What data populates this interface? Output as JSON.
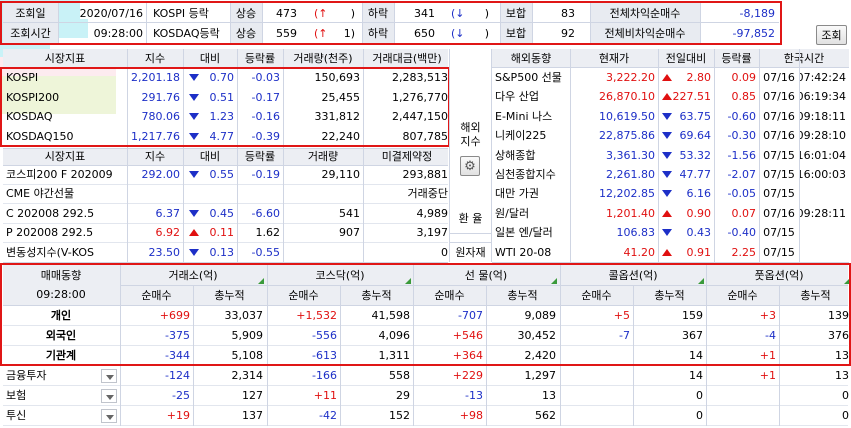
{
  "top": {
    "row1": {
      "label": "조회일",
      "value": "2020/07/16",
      "market": "KOSPI 등락",
      "up_label": "상승",
      "up": "473",
      "up_arrow": "(↑",
      "up_close": ")",
      "down_label": "하락",
      "down": "341",
      "down_arrow": "(↓",
      "down_close": ")",
      "flat_label": "보합",
      "flat": "83",
      "net_label": "전체차익순매수",
      "net": "-8,189"
    },
    "row2": {
      "label": "조회시간",
      "value": "09:28:00",
      "market": "KOSDAQ등락",
      "up_label": "상승",
      "up": "559",
      "up_arrow": "(↑",
      "up_close": "1)",
      "down_label": "하락",
      "down": "650",
      "down_arrow": "(↓",
      "down_close": ")",
      "flat_label": "보합",
      "flat": "92",
      "net_label": "전체비차익순매수",
      "net": "-97,852"
    },
    "query_button": "조회"
  },
  "index_table": {
    "headers": [
      "시장지표",
      "지수",
      "대비",
      "등락률",
      "거래량(천주)",
      "거래대금(백만)"
    ],
    "rows": [
      [
        "KOSPI",
        "2,201.18",
        "0.70",
        "-0.03",
        "150,693",
        "2,283,513"
      ],
      [
        "KOSPI200",
        "291.76",
        "0.51",
        "-0.17",
        "25,455",
        "1,276,770"
      ],
      [
        "KOSDAQ",
        "780.06",
        "1.23",
        "-0.16",
        "331,812",
        "2,447,150"
      ],
      [
        "KOSDAQ150",
        "1,217.76",
        "4.77",
        "-0.39",
        "22,240",
        "807,785"
      ]
    ],
    "headers2": [
      "시장지표",
      "지수",
      "대비",
      "등락률",
      "거래량",
      "미결제약정"
    ],
    "rows2": [
      [
        "코스피200 F 202009",
        "292.00",
        "0.55",
        "-0.19",
        "29,110",
        "293,881"
      ],
      [
        "CME 야간선물",
        "",
        "",
        "",
        "",
        "거래중단"
      ],
      [
        "C 202008 292.5",
        "6.37",
        "0.45",
        "-6.60",
        "541",
        "4,989"
      ],
      [
        "P 202008 292.5",
        "6.92",
        "0.11",
        "1.62",
        "907",
        "3,197"
      ],
      [
        "변동성지수(V-KOS",
        "23.50",
        "0.13",
        "-0.55",
        "",
        "0"
      ]
    ]
  },
  "side_labels": {
    "overseas": "해외\n지수",
    "fx": "환 율",
    "commodity": "원자재"
  },
  "overseas": {
    "headers": [
      "해외동향",
      "현재가",
      "전일대비",
      "등락률",
      "한국시간"
    ],
    "rows": [
      [
        "S&P500 선물",
        "3,222.20",
        "2.80",
        "0.09",
        "07/16",
        "07:42:24"
      ],
      [
        "다우 산업",
        "26,870.10",
        "227.51",
        "0.85",
        "07/16",
        "06:19:34"
      ],
      [
        "E-Mini 나스",
        "10,619.50",
        "63.75",
        "-0.60",
        "07/16",
        "09:18:11"
      ],
      [
        "니케이225",
        "22,875.86",
        "69.64",
        "-0.30",
        "07/16",
        "09:28:10"
      ],
      [
        "상해종합",
        "3,361.30",
        "53.32",
        "-1.56",
        "07/15",
        "16:01:04"
      ],
      [
        "심천종합지수",
        "2,261.80",
        "47.77",
        "-2.07",
        "07/15",
        "16:00:03"
      ],
      [
        "대만 가권",
        "12,202.85",
        "6.16",
        "-0.05",
        "07/15",
        ""
      ],
      [
        "원/달러",
        "1,201.40",
        "0.90",
        "0.07",
        "07/16",
        "09:28:11"
      ],
      [
        "일본 엔/달러",
        "106.83",
        "0.43",
        "-0.40",
        "07/15",
        ""
      ],
      [
        "WTI 20-08",
        "41.20",
        "0.91",
        "2.25",
        "07/15",
        ""
      ]
    ]
  },
  "investor": {
    "title": "매매동향",
    "time": "09:28:00",
    "groups": [
      "거래소(억)",
      "코스닥(억)",
      "선  물(억)",
      "콜옵션(억)",
      "풋옵션(억)"
    ],
    "sub": [
      "순매수",
      "총누적"
    ],
    "rows": [
      {
        "name": "개인",
        "vals": [
          "+699",
          "33,037",
          "+1,532",
          "41,598",
          "-707",
          "9,089",
          "+5",
          "159",
          "+3",
          "139"
        ]
      },
      {
        "name": "외국인",
        "vals": [
          "-375",
          "5,909",
          "-556",
          "4,096",
          "+546",
          "30,452",
          "-7",
          "367",
          "-4",
          "376"
        ]
      },
      {
        "name": "기관계",
        "vals": [
          "-344",
          "5,108",
          "-613",
          "1,311",
          "+364",
          "2,420",
          "",
          "14",
          "+1",
          "13"
        ]
      },
      {
        "name": "금융투자",
        "vals": [
          "-124",
          "2,314",
          "-166",
          "558",
          "+229",
          "1,297",
          "",
          "14",
          "+1",
          "13"
        ]
      },
      {
        "name": "보험",
        "vals": [
          "-25",
          "127",
          "+11",
          "29",
          "-13",
          "13",
          "",
          "0",
          "",
          "0"
        ]
      },
      {
        "name": "투신",
        "vals": [
          "+19",
          "137",
          "-42",
          "152",
          "+98",
          "562",
          "",
          "0",
          "",
          "0"
        ]
      }
    ]
  },
  "colors": {
    "up": "#e01010",
    "down": "#1d2fc7",
    "highlight": "#e01616",
    "header_bg": "#eceef3",
    "cyan": "#c9f2f7",
    "pink": "#fdebef",
    "green": "#eef5d9"
  }
}
